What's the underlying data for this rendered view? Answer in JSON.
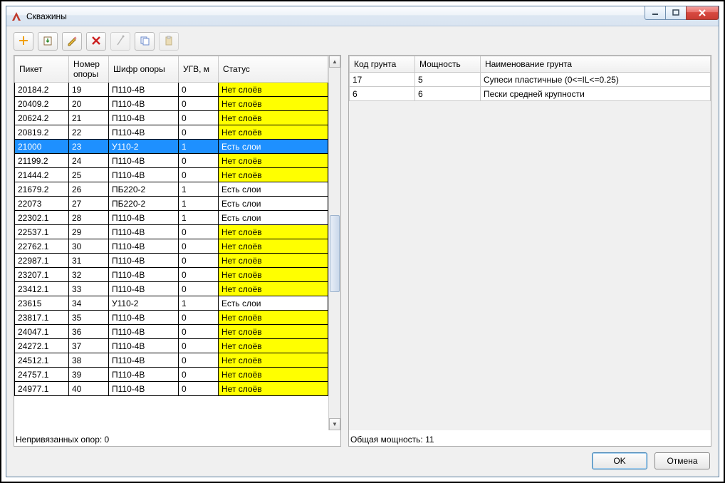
{
  "window": {
    "title": "Скважины"
  },
  "toolbar": {
    "icons": [
      "add-icon",
      "import-icon",
      "edit-icon",
      "delete-icon",
      "link-icon",
      "copy-icon",
      "paste-icon"
    ]
  },
  "left": {
    "columns": [
      "Пикет",
      "Номер опоры",
      "Шифр опоры",
      "УГВ, м",
      "Статус"
    ],
    "status_labels": {
      "no": "Нет слоёв",
      "yes": "Есть слои"
    },
    "selected_index": 4,
    "rows": [
      {
        "piket": "20184.2",
        "num": "19",
        "shifr": "П110-4В",
        "ugv": "0",
        "status": "no"
      },
      {
        "piket": "20409.2",
        "num": "20",
        "shifr": "П110-4В",
        "ugv": "0",
        "status": "no"
      },
      {
        "piket": "20624.2",
        "num": "21",
        "shifr": "П110-4В",
        "ugv": "0",
        "status": "no"
      },
      {
        "piket": "20819.2",
        "num": "22",
        "shifr": "П110-4В",
        "ugv": "0",
        "status": "no"
      },
      {
        "piket": "21000",
        "num": "23",
        "shifr": "У110-2",
        "ugv": "1",
        "status": "yes"
      },
      {
        "piket": "21199.2",
        "num": "24",
        "shifr": "П110-4В",
        "ugv": "0",
        "status": "no"
      },
      {
        "piket": "21444.2",
        "num": "25",
        "shifr": "П110-4В",
        "ugv": "0",
        "status": "no"
      },
      {
        "piket": "21679.2",
        "num": "26",
        "shifr": "ПБ220-2",
        "ugv": "1",
        "status": "yes"
      },
      {
        "piket": "22073",
        "num": "27",
        "shifr": "ПБ220-2",
        "ugv": "1",
        "status": "yes"
      },
      {
        "piket": "22302.1",
        "num": "28",
        "shifr": "П110-4В",
        "ugv": "1",
        "status": "yes"
      },
      {
        "piket": "22537.1",
        "num": "29",
        "shifr": "П110-4В",
        "ugv": "0",
        "status": "no"
      },
      {
        "piket": "22762.1",
        "num": "30",
        "shifr": "П110-4В",
        "ugv": "0",
        "status": "no"
      },
      {
        "piket": "22987.1",
        "num": "31",
        "shifr": "П110-4В",
        "ugv": "0",
        "status": "no"
      },
      {
        "piket": "23207.1",
        "num": "32",
        "shifr": "П110-4В",
        "ugv": "0",
        "status": "no"
      },
      {
        "piket": "23412.1",
        "num": "33",
        "shifr": "П110-4В",
        "ugv": "0",
        "status": "no"
      },
      {
        "piket": "23615",
        "num": "34",
        "shifr": "У110-2",
        "ugv": "1",
        "status": "yes"
      },
      {
        "piket": "23817.1",
        "num": "35",
        "shifr": "П110-4В",
        "ugv": "0",
        "status": "no"
      },
      {
        "piket": "24047.1",
        "num": "36",
        "shifr": "П110-4В",
        "ugv": "0",
        "status": "no"
      },
      {
        "piket": "24272.1",
        "num": "37",
        "shifr": "П110-4В",
        "ugv": "0",
        "status": "no"
      },
      {
        "piket": "24512.1",
        "num": "38",
        "shifr": "П110-4В",
        "ugv": "0",
        "status": "no"
      },
      {
        "piket": "24757.1",
        "num": "39",
        "shifr": "П110-4В",
        "ugv": "0",
        "status": "no"
      },
      {
        "piket": "24977.1",
        "num": "40",
        "shifr": "П110-4В",
        "ugv": "0",
        "status": "no"
      }
    ],
    "status_text": "Непривязанных опор: 0"
  },
  "right": {
    "columns": [
      "Код грунта",
      "Мощность",
      "Наименование грунта"
    ],
    "rows": [
      {
        "code": "17",
        "power": "5",
        "name": "Супеси пластичные (0<=IL<=0.25)"
      },
      {
        "code": "6",
        "power": "6",
        "name": "Пески средней крупности"
      }
    ],
    "status_text": "Общая мощность: 11"
  },
  "footer": {
    "ok": "OK",
    "cancel": "Отмена"
  }
}
